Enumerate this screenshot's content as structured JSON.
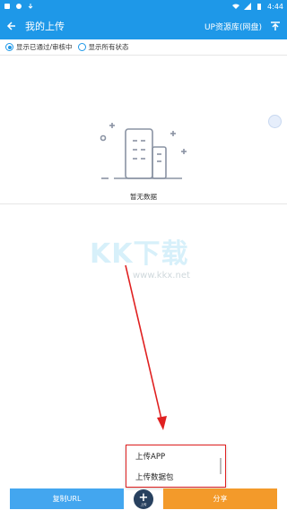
{
  "status_bar": {
    "time": "4:44",
    "left_icons": [
      "notification-icon",
      "app-icon",
      "download-icon"
    ],
    "right_icons": [
      "wifi-icon",
      "signal-icon",
      "battery-icon"
    ]
  },
  "appbar": {
    "title": "我的上传",
    "repo_label": "UP资源库(网盘)",
    "upload_icon": "upload-icon"
  },
  "filters": [
    {
      "label": "显示已通过/审核中",
      "checked": true
    },
    {
      "label": "显示所有状态",
      "checked": false
    }
  ],
  "empty_state": {
    "text": "暂无数据",
    "illustration": "buildings-icon"
  },
  "watermark": {
    "text": "KK下载",
    "url": "www.kkx.net"
  },
  "popup_menu": {
    "items": [
      "上传APP",
      "上传数据包"
    ]
  },
  "bottom_bar": {
    "copy_label": "复制URL",
    "share_label": "分享",
    "fab_label": "上传"
  },
  "colors": {
    "primary": "#1e98e8",
    "share": "#f39a2a",
    "copy": "#43a6ef",
    "highlight": "#e02020"
  }
}
